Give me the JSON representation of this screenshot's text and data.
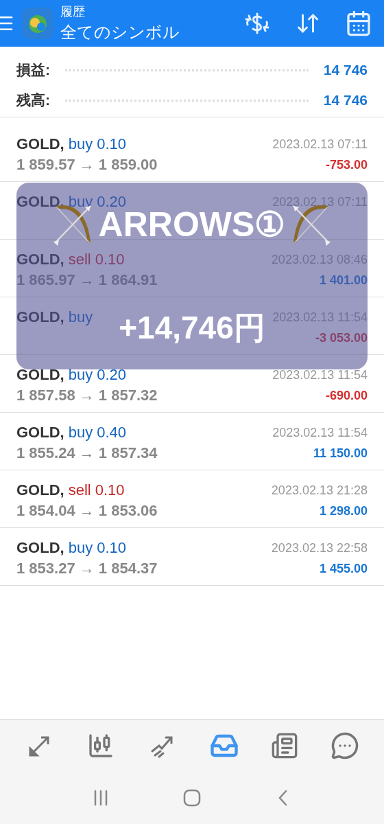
{
  "header": {
    "title": "履歴",
    "subtitle": "全てのシンボル"
  },
  "summary": [
    {
      "label": "損益:",
      "value": "14 746"
    },
    {
      "label": "残高:",
      "value": "14 746"
    }
  ],
  "deals": [
    {
      "symbol": "GOLD,",
      "side": "buy",
      "volume": "0.10",
      "time": "2023.02.13 07:11",
      "prices": "1 859.57 → 1 859.00",
      "profit": "-753.00",
      "kind": "loss"
    },
    {
      "symbol": "GOLD,",
      "side": "buy",
      "volume": "0.20",
      "time": "2023.02.13 07:11"
    },
    {
      "symbol": "GOLD,",
      "side": "sell",
      "volume": "0.10",
      "time": "2023.02.13 08:46",
      "prices": "1 865.97 → 1 864.91",
      "profit": "1 401.00",
      "kind": "gain"
    },
    {
      "symbol": "GOLD,",
      "side": "buy",
      "time": "2023.02.13 11:54",
      "profit": "-3 053.00",
      "kind": "loss"
    },
    {
      "symbol": "GOLD,",
      "side": "buy",
      "volume": "0.20",
      "time": "2023.02.13 11:54",
      "prices": "1 857.58 → 1 857.32",
      "profit": "-690.00",
      "kind": "loss"
    },
    {
      "symbol": "GOLD,",
      "side": "buy",
      "volume": "0.40",
      "time": "2023.02.13 11:54",
      "prices": "1 855.24 → 1 857.34",
      "profit": "11 150.00",
      "kind": "gain"
    },
    {
      "symbol": "GOLD,",
      "side": "sell",
      "volume": "0.10",
      "time": "2023.02.13 21:28",
      "prices": "1 854.04 → 1 853.06",
      "profit": "1 298.00",
      "kind": "gain"
    },
    {
      "symbol": "GOLD,",
      "side": "buy",
      "volume": "0.10",
      "time": "2023.02.13 22:58",
      "prices": "1 853.27 → 1 854.37",
      "profit": "1 455.00",
      "kind": "gain"
    }
  ],
  "overlay": {
    "title": "ARROWS①",
    "amount": "+14,746円"
  },
  "bottom_nav": [
    {
      "selected": false
    },
    {
      "selected": false
    },
    {
      "selected": false
    },
    {
      "selected": true
    },
    {
      "selected": false
    },
    {
      "selected": false
    }
  ]
}
